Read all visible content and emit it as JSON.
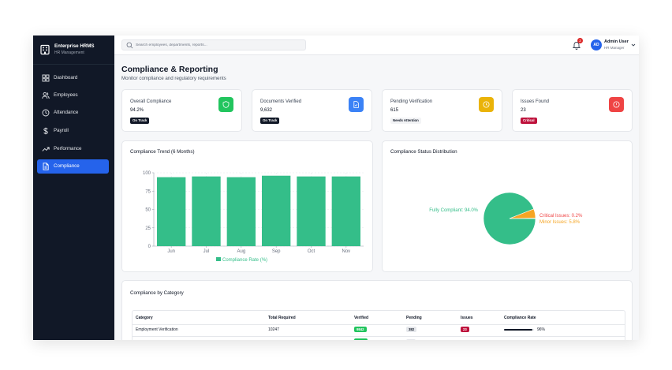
{
  "app": {
    "title": "Enterprise HRMS",
    "subtitle": "HR Management"
  },
  "sidebar": {
    "items": [
      {
        "label": "Dashboard",
        "icon": "dashboard-icon",
        "active": false
      },
      {
        "label": "Employees",
        "icon": "users-icon",
        "active": false
      },
      {
        "label": "Attendance",
        "icon": "clock-icon",
        "active": false
      },
      {
        "label": "Payroll",
        "icon": "dollar-icon",
        "active": false
      },
      {
        "label": "Performance",
        "icon": "trend-icon",
        "active": false
      },
      {
        "label": "Compliance",
        "icon": "document-icon",
        "active": true
      }
    ]
  },
  "topbar": {
    "search_placeholder": "Search employees, departments, reports...",
    "notification_count": "2",
    "user_initials": "AD",
    "user_name": "Admin User",
    "user_role": "HR Manager"
  },
  "page": {
    "title": "Compliance & Reporting",
    "subtitle": "Monitor compliance and regulatory requirements"
  },
  "stats": [
    {
      "label": "Overall Compliance",
      "value": "94.2%",
      "badge": "On Track",
      "badge_bg": "#111827",
      "badge_color": "#ffffff",
      "icon": "shield-icon",
      "icon_bg": "#22c55e"
    },
    {
      "label": "Documents Verified",
      "value": "9,632",
      "badge": "On Track",
      "badge_bg": "#111827",
      "badge_color": "#ffffff",
      "icon": "file-check-icon",
      "icon_bg": "#3b82f6"
    },
    {
      "label": "Pending Verification",
      "value": "615",
      "badge": "Needs Attention",
      "badge_bg": "#f3f4f6",
      "badge_color": "#111827",
      "icon": "clock-icon",
      "icon_bg": "#eab308"
    },
    {
      "label": "Issues Found",
      "value": "23",
      "badge": "Critical",
      "badge_bg": "#be123c",
      "badge_color": "#ffffff",
      "icon": "alert-icon",
      "icon_bg": "#ef4444"
    }
  ],
  "charts_text": {
    "trend_title": "Compliance Trend (6 Months)",
    "status_title": "Compliance Status Distribution"
  },
  "chart_data": [
    {
      "type": "bar",
      "title": "Compliance Trend (6 Months)",
      "categories": [
        "Jun",
        "Jul",
        "Aug",
        "Sep",
        "Oct",
        "Nov"
      ],
      "series": [
        {
          "name": "Compliance Rate (%)",
          "values": [
            94,
            95,
            94,
            96,
            95,
            95
          ],
          "color": "#34be89"
        }
      ],
      "ylim": [
        0,
        100
      ],
      "yticks": [
        0,
        25,
        50,
        75,
        100
      ],
      "grid": true,
      "legend": "bottom"
    },
    {
      "type": "pie",
      "title": "Compliance Status Distribution",
      "slices": [
        {
          "label": "Fully Compliant: 94.0%",
          "value": 94.0,
          "color": "#34be89"
        },
        {
          "label": "Minor Issues: 5.8%",
          "value": 5.8,
          "color": "#f5a524"
        },
        {
          "label": "Critical Issues: 0.2%",
          "value": 0.2,
          "color": "#ef4444"
        }
      ]
    }
  ],
  "category_table": {
    "title": "Compliance by Category",
    "headers": [
      "Category",
      "Total Required",
      "Verified",
      "Pending",
      "Issues",
      "Compliance Rate"
    ],
    "rows": [
      {
        "category": "Employment Verification",
        "total": "10247",
        "verified": "9842",
        "pending": "382",
        "issues": "23",
        "rate_text": "96%",
        "rate": 0.96
      }
    ],
    "colors": {
      "verified_bg": "#22c55e",
      "pending_bg": "#e5e7eb",
      "issues_bg": "#be123c",
      "bar_fill": "#111827",
      "bar_track": "#e5e7eb"
    }
  }
}
